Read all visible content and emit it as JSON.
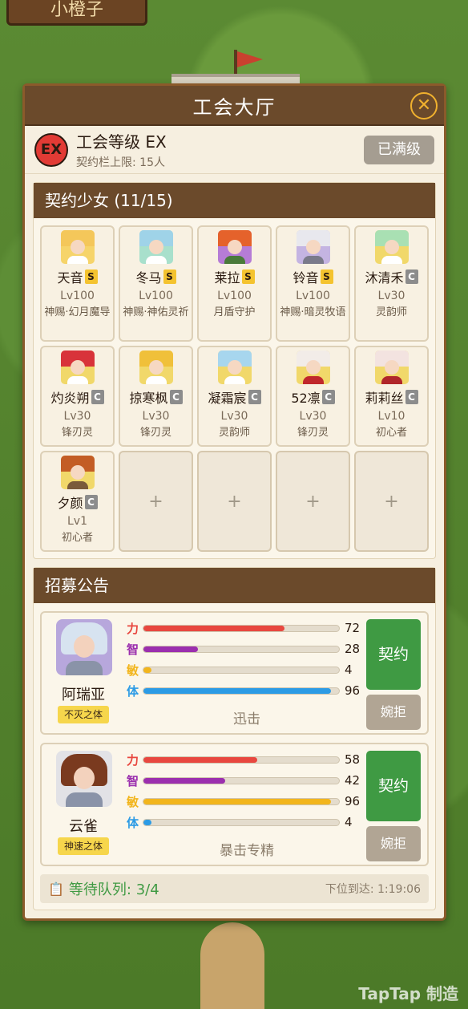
{
  "background": {
    "sign_text": "小橙子",
    "watermark": "TapTap 制造"
  },
  "modal": {
    "title": "工会大厅",
    "close_icon": "close-icon"
  },
  "guild": {
    "badge": "EX",
    "level_label": "工会等级 EX",
    "cap_label": "契约栏上限: 15人",
    "maxed_button": "已满级"
  },
  "contracts": {
    "header": "契约少女 (11/15)",
    "girls": [
      {
        "name": "天音",
        "rank": "S",
        "level": "Lv100",
        "class": "神赐·幻月魔导",
        "hair": "#f4c75a",
        "bg": "#f6d46a",
        "outfit": "#ffffff"
      },
      {
        "name": "冬马",
        "rank": "S",
        "level": "Lv100",
        "class": "神赐·神佑灵祈",
        "hair": "#9fd3e8",
        "bg": "#a8e0cc",
        "outfit": "#ffffff"
      },
      {
        "name": "莱拉",
        "rank": "S",
        "level": "Lv100",
        "class": "月盾守护",
        "hair": "#e5622b",
        "bg": "#b67cd6",
        "outfit": "#4a7a3a"
      },
      {
        "name": "铃音",
        "rank": "S",
        "level": "Lv100",
        "class": "神赐·暗灵牧语",
        "hair": "#e8e8ee",
        "bg": "#c4b4e2",
        "outfit": "#7a7a8a"
      },
      {
        "name": "沐清禾",
        "rank": "C",
        "level": "Lv30",
        "class": "灵韵师",
        "hair": "#a9e0b3",
        "bg": "#f1d86a",
        "outfit": "#ffffff"
      },
      {
        "name": "灼炎朔",
        "rank": "C",
        "level": "Lv30",
        "class": "锋刃灵",
        "hair": "#d8333a",
        "bg": "#f1d86a",
        "outfit": "#ffffff"
      },
      {
        "name": "掠寒枫",
        "rank": "C",
        "level": "Lv30",
        "class": "锋刃灵",
        "hair": "#f0c03a",
        "bg": "#f1d86a",
        "outfit": "#ffffff"
      },
      {
        "name": "凝霜宸",
        "rank": "C",
        "level": "Lv30",
        "class": "灵韵师",
        "hair": "#a7d6ee",
        "bg": "#f1d86a",
        "outfit": "#ffffff"
      },
      {
        "name": "52凛",
        "rank": "C",
        "level": "Lv30",
        "class": "锋刃灵",
        "hair": "#f2ece8",
        "bg": "#f1d86a",
        "outfit": "#c0282c"
      },
      {
        "name": "莉莉丝",
        "rank": "C",
        "level": "Lv10",
        "class": "初心者",
        "hair": "#f3e3e0",
        "bg": "#f1d86a",
        "outfit": "#b0262a"
      },
      {
        "name": "夕颜",
        "rank": "C",
        "level": "Lv1",
        "class": "初心者",
        "hair": "#c35d25",
        "bg": "#f1d86a",
        "outfit": "#7a5a3a"
      }
    ],
    "empty_slot_label": "+"
  },
  "recruit": {
    "header": "招募公告",
    "stat_labels": [
      "力",
      "智",
      "敏",
      "体"
    ],
    "stat_colors": [
      "#e8473f",
      "#9b2fae",
      "#f2b51c",
      "#2c9be5"
    ],
    "candidates": [
      {
        "name": "阿瑞亚",
        "trait": "不灭之体",
        "stats": [
          72,
          28,
          4,
          96
        ],
        "skill": "迅击",
        "contract": "契约",
        "decline": "婉拒",
        "hair": "#d7e3f0",
        "bg": "#b7a7dc"
      },
      {
        "name": "云雀",
        "trait": "神速之体",
        "stats": [
          58,
          42,
          96,
          4
        ],
        "skill": "暴击专精",
        "contract": "契约",
        "decline": "婉拒",
        "hair": "#7a3a1f",
        "bg": "#e2e2e6"
      }
    ]
  },
  "queue": {
    "icon": "clipboard-icon",
    "label": "等待队列: 3/4",
    "next_label": "下位到达: 1:19:06"
  }
}
